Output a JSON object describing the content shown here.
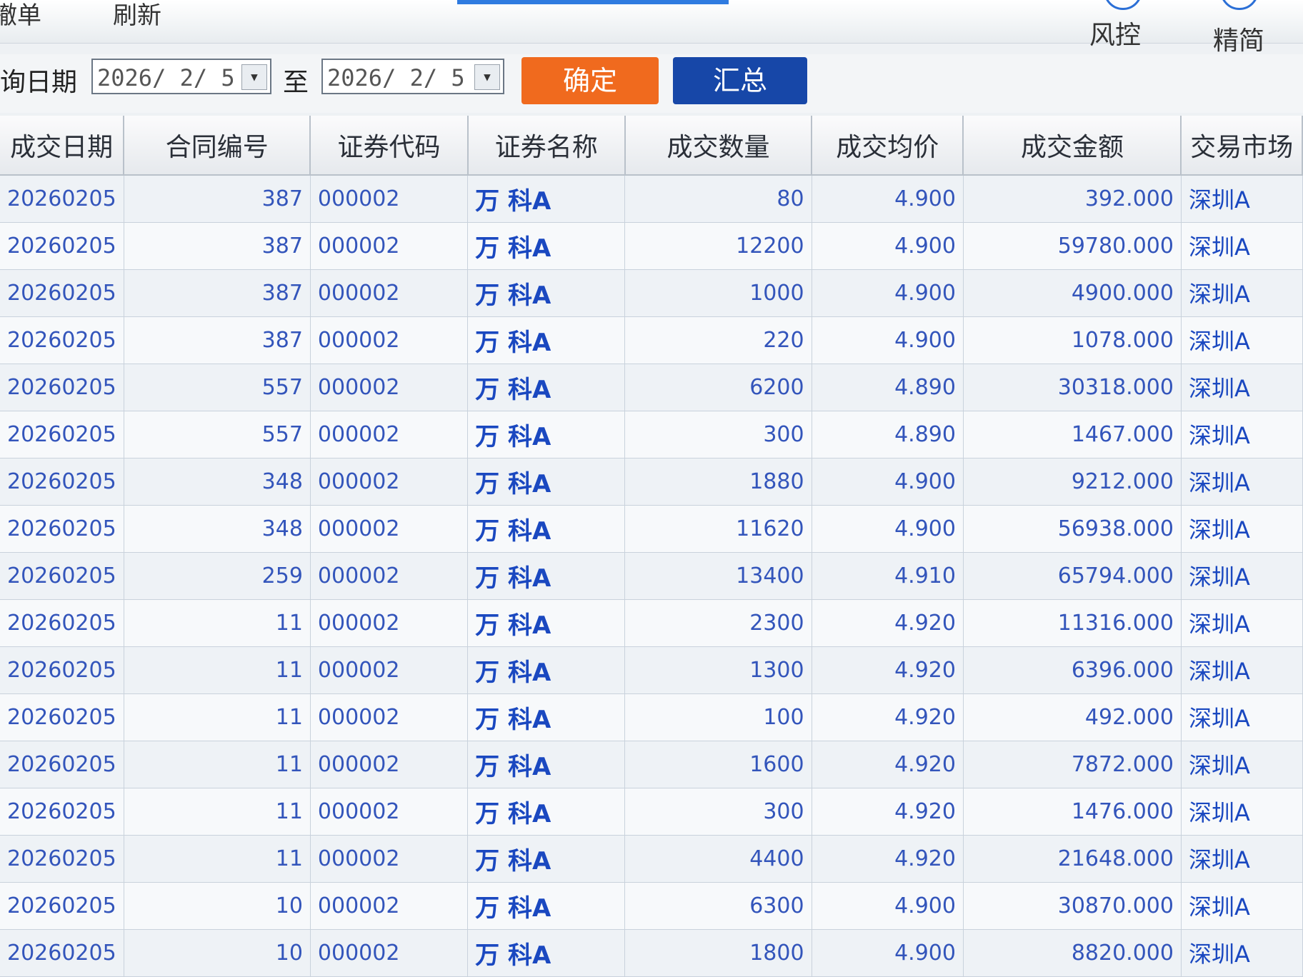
{
  "toolbar": {
    "left_items": [
      "撤单",
      "刷新"
    ],
    "right_items": [
      "风控",
      "精简"
    ]
  },
  "filter": {
    "label": "查询日期",
    "start_date": "2026/ 2/ 5",
    "to_label": "至",
    "end_date": "2026/ 2/ 5",
    "confirm_label": "确定",
    "summary_label": "汇总"
  },
  "colors": {
    "confirm": "#f06a1e",
    "summary": "#1747a8"
  },
  "table": {
    "headers": [
      "成交日期",
      "合同编号",
      "证券代码",
      "证券名称",
      "成交数量",
      "成交均价",
      "成交金额",
      "交易市场"
    ],
    "rows": [
      [
        "20260205",
        "387",
        "000002",
        "万 科A",
        "80",
        "4.900",
        "392.000",
        "深圳A"
      ],
      [
        "20260205",
        "387",
        "000002",
        "万 科A",
        "12200",
        "4.900",
        "59780.000",
        "深圳A"
      ],
      [
        "20260205",
        "387",
        "000002",
        "万 科A",
        "1000",
        "4.900",
        "4900.000",
        "深圳A"
      ],
      [
        "20260205",
        "387",
        "000002",
        "万 科A",
        "220",
        "4.900",
        "1078.000",
        "深圳A"
      ],
      [
        "20260205",
        "557",
        "000002",
        "万 科A",
        "6200",
        "4.890",
        "30318.000",
        "深圳A"
      ],
      [
        "20260205",
        "557",
        "000002",
        "万 科A",
        "300",
        "4.890",
        "1467.000",
        "深圳A"
      ],
      [
        "20260205",
        "348",
        "000002",
        "万 科A",
        "1880",
        "4.900",
        "9212.000",
        "深圳A"
      ],
      [
        "20260205",
        "348",
        "000002",
        "万 科A",
        "11620",
        "4.900",
        "56938.000",
        "深圳A"
      ],
      [
        "20260205",
        "259",
        "000002",
        "万 科A",
        "13400",
        "4.910",
        "65794.000",
        "深圳A"
      ],
      [
        "20260205",
        "11",
        "000002",
        "万 科A",
        "2300",
        "4.920",
        "11316.000",
        "深圳A"
      ],
      [
        "20260205",
        "11",
        "000002",
        "万 科A",
        "1300",
        "4.920",
        "6396.000",
        "深圳A"
      ],
      [
        "20260205",
        "11",
        "000002",
        "万 科A",
        "100",
        "4.920",
        "492.000",
        "深圳A"
      ],
      [
        "20260205",
        "11",
        "000002",
        "万 科A",
        "1600",
        "4.920",
        "7872.000",
        "深圳A"
      ],
      [
        "20260205",
        "11",
        "000002",
        "万 科A",
        "300",
        "4.920",
        "1476.000",
        "深圳A"
      ],
      [
        "20260205",
        "11",
        "000002",
        "万 科A",
        "4400",
        "4.920",
        "21648.000",
        "深圳A"
      ],
      [
        "20260205",
        "10",
        "000002",
        "万 科A",
        "6300",
        "4.900",
        "30870.000",
        "深圳A"
      ],
      [
        "20260205",
        "10",
        "000002",
        "万 科A",
        "1800",
        "4.900",
        "8820.000",
        "深圳A"
      ]
    ]
  }
}
